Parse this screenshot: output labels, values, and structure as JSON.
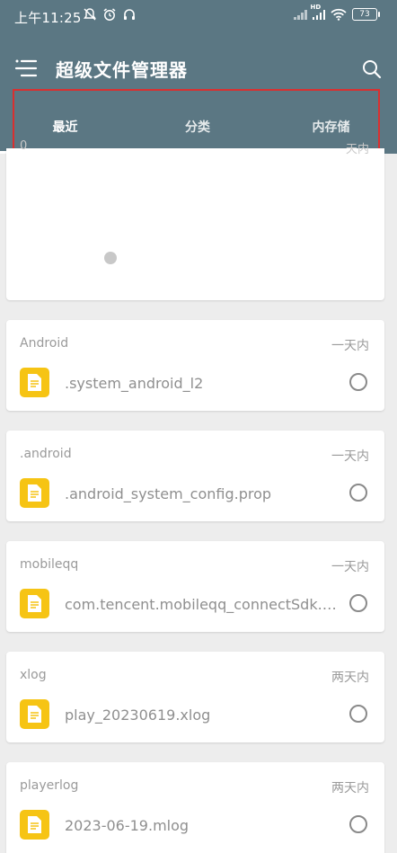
{
  "status_bar": {
    "time": "上午11:25",
    "left_icons": [
      "bell-off-icon",
      "alarm-icon",
      "headset-icon"
    ],
    "network": "HD",
    "battery": "73"
  },
  "toolbar": {
    "title": "超级文件管理器",
    "menu_icon": "menu-icon",
    "search_icon": "search-icon"
  },
  "tabs": [
    {
      "label": "最近",
      "active": true
    },
    {
      "label": "分类",
      "active": false
    },
    {
      "label": "内存储",
      "active": false
    }
  ],
  "top_card": {
    "partial_left": "0",
    "partial_right": "天内"
  },
  "recent_groups": [
    {
      "folder": "Android",
      "time": "一天内",
      "file": ".system_android_l2"
    },
    {
      "folder": ".android",
      "time": "一天内",
      "file": ".android_system_config.prop"
    },
    {
      "folder": "mobileqq",
      "time": "一天内",
      "file": "com.tencent.mobileqq_connectSdk.log"
    },
    {
      "folder": "xlog",
      "time": "两天内",
      "file": "play_20230619.xlog"
    },
    {
      "folder": "playerlog",
      "time": "两天内",
      "file": "2023-06-19.mlog"
    }
  ],
  "colors": {
    "header": "#5b7783",
    "file_icon": "#f6c414",
    "highlight_box": "#d93030"
  }
}
